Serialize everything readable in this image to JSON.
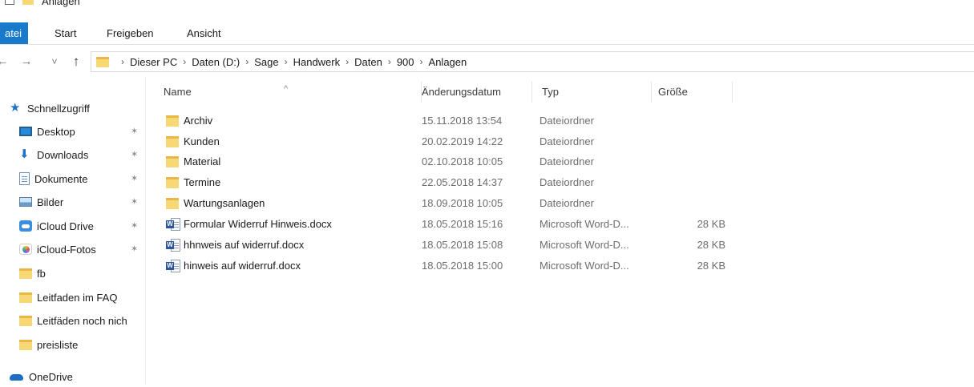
{
  "title_bar": {
    "title": "Anlagen"
  },
  "ribbon": {
    "tabs": [
      "Datei",
      "Start",
      "Freigeben",
      "Ansicht"
    ],
    "file_tab_visible_text": "atei"
  },
  "navigation": {
    "back": "←",
    "forward": "→",
    "recent": "˅",
    "up": "↑",
    "breadcrumb": [
      "Dieser PC",
      "Daten (D:)",
      "Sage",
      "Handwerk",
      "Daten",
      "900",
      "Anlagen"
    ]
  },
  "nav_pane": {
    "quick_access_label": "Schnellzugriff",
    "items": [
      {
        "label": "Desktop",
        "icon": "desktop-icon",
        "pinned": true
      },
      {
        "label": "Downloads",
        "icon": "download-icon",
        "pinned": true
      },
      {
        "label": "Dokumente",
        "icon": "document-icon",
        "pinned": true
      },
      {
        "label": "Bilder",
        "icon": "pictures-icon",
        "pinned": true
      },
      {
        "label": "iCloud Drive",
        "icon": "icloud-icon",
        "pinned": true
      },
      {
        "label": "iCloud-Fotos",
        "icon": "photos-icon",
        "pinned": true
      },
      {
        "label": "fb",
        "icon": "folder-icon",
        "pinned": false
      },
      {
        "label": "Leitfaden im FAQ",
        "icon": "folder-icon",
        "pinned": false
      },
      {
        "label": "Leitfäden noch nich",
        "icon": "folder-icon",
        "pinned": false
      },
      {
        "label": "preisliste",
        "icon": "folder-icon",
        "pinned": false
      }
    ],
    "onedrive_label": "OneDrive",
    "pin_glyph": "✶"
  },
  "file_list": {
    "columns": {
      "name": "Name",
      "date": "Änderungsdatum",
      "type": "Typ",
      "size": "Größe"
    },
    "sort_glyph": "^",
    "rows": [
      {
        "name": "Archiv",
        "date": "15.11.2018 13:54",
        "type": "Dateiordner",
        "size": "",
        "kind": "folder"
      },
      {
        "name": "Kunden",
        "date": "20.02.2019 14:22",
        "type": "Dateiordner",
        "size": "",
        "kind": "folder"
      },
      {
        "name": "Material",
        "date": "02.10.2018 10:05",
        "type": "Dateiordner",
        "size": "",
        "kind": "folder"
      },
      {
        "name": "Termine",
        "date": "22.05.2018 14:37",
        "type": "Dateiordner",
        "size": "",
        "kind": "folder"
      },
      {
        "name": "Wartungsanlagen",
        "date": "18.09.2018 10:05",
        "type": "Dateiordner",
        "size": "",
        "kind": "folder"
      },
      {
        "name": "Formular Widerruf Hinweis.docx",
        "date": "18.05.2018 15:16",
        "type": "Microsoft Word-D...",
        "size": "28 KB",
        "kind": "word"
      },
      {
        "name": "hhnweis auf widerruf.docx",
        "date": "18.05.2018 15:08",
        "type": "Microsoft Word-D...",
        "size": "28 KB",
        "kind": "word"
      },
      {
        "name": "hinweis auf widerruf.docx",
        "date": "18.05.2018 15:00",
        "type": "Microsoft Word-D...",
        "size": "28 KB",
        "kind": "word"
      }
    ]
  },
  "colors": {
    "file_tab": "#1979ca",
    "folder": "#f8d775",
    "word": "#2b579a",
    "secondary_text": "#6d6d6d"
  }
}
